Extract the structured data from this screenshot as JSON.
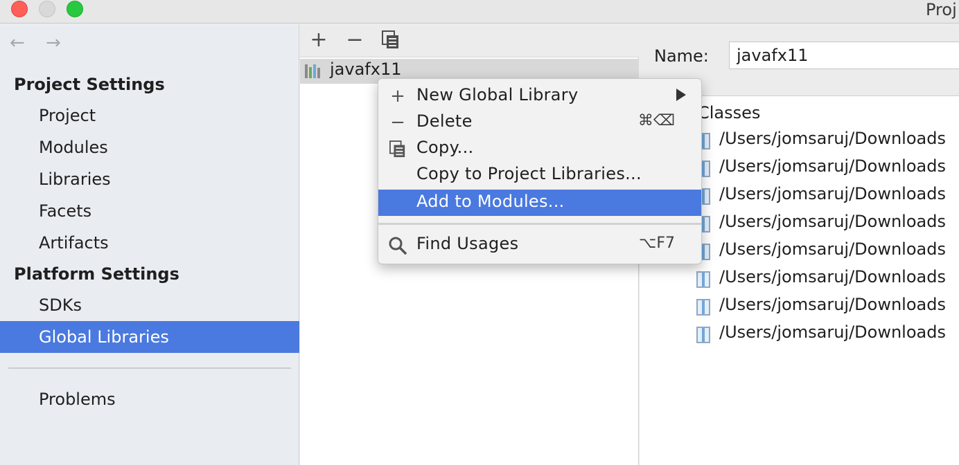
{
  "window": {
    "title": "Proj"
  },
  "nav": {
    "back": "←",
    "forward": "→"
  },
  "sidebar": {
    "project_settings_header": "Project Settings",
    "project_items": [
      {
        "label": "Project"
      },
      {
        "label": "Modules"
      },
      {
        "label": "Libraries"
      },
      {
        "label": "Facets"
      },
      {
        "label": "Artifacts"
      }
    ],
    "platform_settings_header": "Platform Settings",
    "platform_items": [
      {
        "label": "SDKs"
      },
      {
        "label": "Global Libraries"
      }
    ],
    "problems": "Problems",
    "selected": "Global Libraries"
  },
  "toolbar": {
    "add": "+",
    "remove": "−"
  },
  "library": {
    "name": "javafx11"
  },
  "details": {
    "name_label": "Name:",
    "name_value": "javafx11",
    "classes_header": "Classes",
    "jar_paths": [
      "/Users/jomsaruj/Downloads",
      "/Users/jomsaruj/Downloads",
      "/Users/jomsaruj/Downloads",
      "/Users/jomsaruj/Downloads",
      "/Users/jomsaruj/Downloads",
      "/Users/jomsaruj/Downloads",
      "/Users/jomsaruj/Downloads",
      "/Users/jomsaruj/Downloads"
    ]
  },
  "context_menu": {
    "items": [
      {
        "label": "New Global Library",
        "icon": "plus-icon",
        "glyph": "+",
        "shortcut": "",
        "submenu": true
      },
      {
        "label": "Delete",
        "icon": "minus-icon",
        "glyph": "−",
        "shortcut": "⌘⌫",
        "submenu": false
      },
      {
        "label": "Copy...",
        "icon": "copy-icon",
        "glyph": "",
        "shortcut": "",
        "submenu": false
      },
      {
        "label": "Copy to Project Libraries...",
        "icon": "",
        "glyph": "",
        "shortcut": "",
        "submenu": false
      },
      {
        "label": "Add to Modules...",
        "icon": "",
        "glyph": "",
        "shortcut": "",
        "submenu": false,
        "selected": true
      }
    ],
    "find_usages": {
      "label": "Find Usages",
      "icon": "search-icon",
      "shortcut": "⌥F7"
    }
  },
  "colors": {
    "selection": "#4a79df",
    "sidebar_bg": "#e9edf2",
    "close": "#ff5f57",
    "maximize": "#28c940"
  }
}
